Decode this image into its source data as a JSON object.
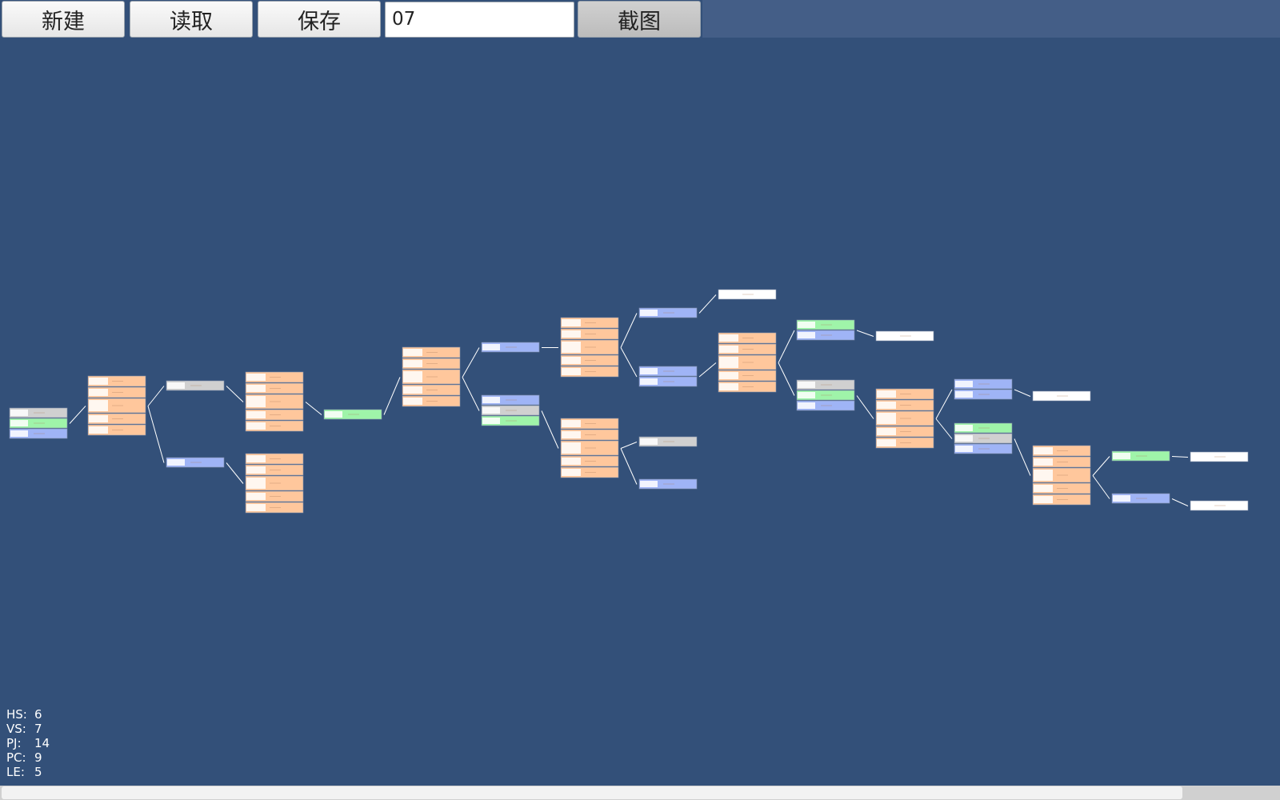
{
  "toolbar": {
    "new_label": "新建",
    "load_label": "读取",
    "save_label": "保存",
    "filename_value": "07",
    "screenshot_label": "截图"
  },
  "stats": [
    {
      "key": "HS:",
      "value": "6"
    },
    {
      "key": "VS:",
      "value": "7"
    },
    {
      "key": "PJ:",
      "value": "14"
    },
    {
      "key": "PC:",
      "value": "9"
    },
    {
      "key": "LE:",
      "value": "5"
    }
  ],
  "colors": {
    "background": "#335079",
    "hs": "#d0d0d0",
    "vs": "#9fb4f6",
    "pj": "#ffc79c",
    "pc": "#9ff4a9",
    "le": "#ffffff",
    "link": "#ffffff"
  },
  "scrollbar": {
    "fraction_visible": 0.925
  },
  "graph": {
    "nodes": [
      {
        "id": "n1",
        "rows": [
          "hs",
          "pc",
          "vs"
        ]
      },
      {
        "id": "n2",
        "rows": [
          "pj",
          "pj",
          "pj",
          "pj",
          "pj"
        ]
      },
      {
        "id": "n3",
        "rows": [
          "hs"
        ]
      },
      {
        "id": "n4",
        "rows": [
          "vs"
        ]
      },
      {
        "id": "n5",
        "rows": [
          "pj",
          "pj",
          "pj",
          "pj",
          "pj"
        ]
      },
      {
        "id": "n6",
        "rows": [
          "pj",
          "pj",
          "pj",
          "pj",
          "pj"
        ]
      },
      {
        "id": "n7",
        "rows": [
          "pc"
        ]
      },
      {
        "id": "n8",
        "rows": [
          "pj",
          "pj",
          "pj",
          "pj",
          "pj"
        ]
      },
      {
        "id": "n9",
        "rows": [
          "vs"
        ]
      },
      {
        "id": "n10",
        "rows": [
          "vs",
          "hs",
          "pc"
        ]
      },
      {
        "id": "n11",
        "rows": [
          "pj",
          "pj",
          "pj",
          "pj",
          "pj"
        ]
      },
      {
        "id": "n12",
        "rows": [
          "pj",
          "pj",
          "pj",
          "pj",
          "pj"
        ]
      },
      {
        "id": "n13",
        "rows": [
          "vs"
        ]
      },
      {
        "id": "n14",
        "rows": [
          "vs",
          "vs"
        ]
      },
      {
        "id": "n15",
        "rows": [
          "hs"
        ]
      },
      {
        "id": "n16",
        "rows": [
          "vs"
        ]
      },
      {
        "id": "n17",
        "rows": [
          "le"
        ]
      },
      {
        "id": "n18",
        "rows": [
          "pj",
          "pj",
          "pj",
          "pj",
          "pj"
        ]
      },
      {
        "id": "n19",
        "rows": [
          "pc",
          "vs"
        ]
      },
      {
        "id": "n20",
        "rows": [
          "hs",
          "pc",
          "vs"
        ]
      },
      {
        "id": "n21",
        "rows": [
          "le"
        ]
      },
      {
        "id": "n22",
        "rows": [
          "pj",
          "pj",
          "pj",
          "pj",
          "pj"
        ]
      },
      {
        "id": "n23",
        "rows": [
          "vs",
          "vs"
        ]
      },
      {
        "id": "n24",
        "rows": [
          "pc",
          "hs",
          "vs"
        ]
      },
      {
        "id": "n25",
        "rows": [
          "le"
        ]
      },
      {
        "id": "n26",
        "rows": [
          "pj",
          "pj",
          "pj",
          "pj",
          "pj"
        ]
      },
      {
        "id": "n27",
        "rows": [
          "pc"
        ]
      },
      {
        "id": "n28",
        "rows": [
          "vs"
        ]
      },
      {
        "id": "n29",
        "rows": [
          "le"
        ]
      },
      {
        "id": "n30",
        "rows": [
          "le"
        ]
      }
    ],
    "edges": [
      [
        "n1",
        "n2"
      ],
      [
        "n2",
        "n3"
      ],
      [
        "n2",
        "n4"
      ],
      [
        "n3",
        "n5"
      ],
      [
        "n4",
        "n6"
      ],
      [
        "n5",
        "n7"
      ],
      [
        "n7",
        "n8"
      ],
      [
        "n8",
        "n9"
      ],
      [
        "n8",
        "n10"
      ],
      [
        "n9",
        "n11"
      ],
      [
        "n10",
        "n12"
      ],
      [
        "n11",
        "n13"
      ],
      [
        "n11",
        "n14"
      ],
      [
        "n12",
        "n15"
      ],
      [
        "n12",
        "n16"
      ],
      [
        "n13",
        "n17"
      ],
      [
        "n14",
        "n18"
      ],
      [
        "n18",
        "n19"
      ],
      [
        "n18",
        "n20"
      ],
      [
        "n19",
        "n21"
      ],
      [
        "n20",
        "n22"
      ],
      [
        "n22",
        "n23"
      ],
      [
        "n22",
        "n24"
      ],
      [
        "n23",
        "n25"
      ],
      [
        "n24",
        "n26"
      ],
      [
        "n26",
        "n27"
      ],
      [
        "n26",
        "n28"
      ],
      [
        "n27",
        "n29"
      ],
      [
        "n28",
        "n30"
      ]
    ]
  }
}
